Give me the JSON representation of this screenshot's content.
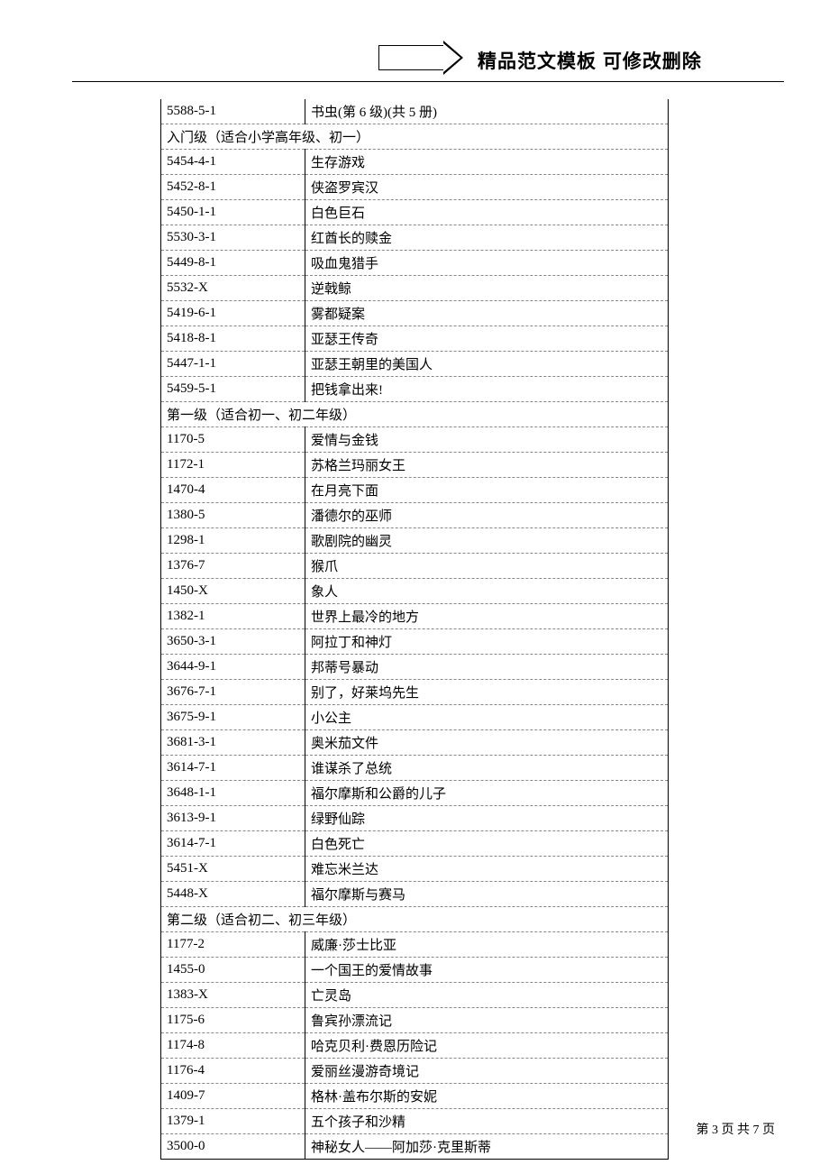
{
  "header": {
    "title": "精品范文模板 可修改删除"
  },
  "rows": [
    {
      "type": "row",
      "code": "5588-5-1",
      "title": "书虫(第 6 级)(共 5 册)"
    },
    {
      "type": "section",
      "label": "入门级（适合小学高年级、初一）"
    },
    {
      "type": "row",
      "code": "5454-4-1",
      "title": "生存游戏"
    },
    {
      "type": "row",
      "code": "5452-8-1",
      "title": "侠盗罗宾汉"
    },
    {
      "type": "row",
      "code": "5450-1-1",
      "title": "白色巨石"
    },
    {
      "type": "row",
      "code": "5530-3-1",
      "title": "红酋长的赎金"
    },
    {
      "type": "row",
      "code": "5449-8-1",
      "title": "吸血鬼猎手"
    },
    {
      "type": "row",
      "code": "5532-X",
      "title": "逆戟鲸"
    },
    {
      "type": "row",
      "code": "5419-6-1",
      "title": "雾都疑案"
    },
    {
      "type": "row",
      "code": "5418-8-1",
      "title": "亚瑟王传奇"
    },
    {
      "type": "row",
      "code": "5447-1-1",
      "title": "亚瑟王朝里的美国人"
    },
    {
      "type": "row",
      "code": "5459-5-1",
      "title": "把钱拿出来!"
    },
    {
      "type": "section",
      "label": "第一级（适合初一、初二年级）"
    },
    {
      "type": "row",
      "code": "1170-5",
      "title": "爱情与金钱"
    },
    {
      "type": "row",
      "code": "1172-1",
      "title": "苏格兰玛丽女王"
    },
    {
      "type": "row",
      "code": "1470-4",
      "title": "在月亮下面"
    },
    {
      "type": "row",
      "code": "1380-5",
      "title": "潘德尔的巫师"
    },
    {
      "type": "row",
      "code": "1298-1",
      "title": "歌剧院的幽灵"
    },
    {
      "type": "row",
      "code": "1376-7",
      "title": "猴爪"
    },
    {
      "type": "row",
      "code": "1450-X",
      "title": "象人"
    },
    {
      "type": "row",
      "code": "1382-1",
      "title": "世界上最冷的地方"
    },
    {
      "type": "row",
      "code": "3650-3-1",
      "title": "阿拉丁和神灯"
    },
    {
      "type": "row",
      "code": "3644-9-1",
      "title": "邦蒂号暴动"
    },
    {
      "type": "row",
      "code": "3676-7-1",
      "title": "别了，好莱坞先生"
    },
    {
      "type": "row",
      "code": "3675-9-1",
      "title": "小公主"
    },
    {
      "type": "row",
      "code": "3681-3-1",
      "title": "奥米茄文件"
    },
    {
      "type": "row",
      "code": "3614-7-1",
      "title": "谁谋杀了总统"
    },
    {
      "type": "row",
      "code": "3648-1-1",
      "title": "福尔摩斯和公爵的儿子"
    },
    {
      "type": "row",
      "code": "3613-9-1",
      "title": "绿野仙踪"
    },
    {
      "type": "row",
      "code": "3614-7-1",
      "title": "白色死亡"
    },
    {
      "type": "row",
      "code": "5451-X",
      "title": "难忘米兰达"
    },
    {
      "type": "row",
      "code": "5448-X",
      "title": "福尔摩斯与赛马"
    },
    {
      "type": "section",
      "label": "第二级（适合初二、初三年级）"
    },
    {
      "type": "row",
      "code": "1177-2",
      "title": "威廉·莎士比亚"
    },
    {
      "type": "row",
      "code": "1455-0",
      "title": "一个国王的爱情故事"
    },
    {
      "type": "row",
      "code": "1383-X",
      "title": "亡灵岛"
    },
    {
      "type": "row",
      "code": "1175-6",
      "title": "鲁宾孙漂流记"
    },
    {
      "type": "row",
      "code": "1174-8",
      "title": "哈克贝利·费恩历险记"
    },
    {
      "type": "row",
      "code": "1176-4",
      "title": "爱丽丝漫游奇境记"
    },
    {
      "type": "row",
      "code": "1409-7",
      "title": "格林·盖布尔斯的安妮"
    },
    {
      "type": "row",
      "code": "1379-1",
      "title": "五个孩子和沙精"
    },
    {
      "type": "row",
      "code": "3500-0",
      "title": "神秘女人——阿加莎·克里斯蒂"
    }
  ],
  "footer": {
    "page_current": "3",
    "page_total": "7",
    "prefix": "第",
    "mid": "页 共",
    "suffix": "页"
  }
}
